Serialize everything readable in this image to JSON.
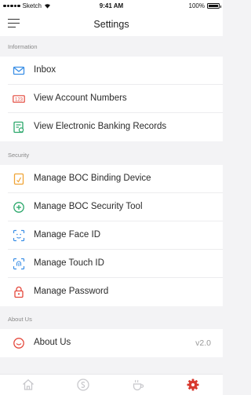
{
  "status_bar": {
    "carrier": "Sketch",
    "time": "9:41 AM",
    "battery": "100%"
  },
  "nav": {
    "title": "Settings",
    "menu_icon": "menu-icon"
  },
  "sections": [
    {
      "header": "Information",
      "items": [
        {
          "label": "Inbox",
          "icon": "envelope-icon",
          "color": "#3b8fe6"
        },
        {
          "label": "View Account Numbers",
          "icon": "account-number-icon",
          "color": "#e4483c",
          "icon_text": "123"
        },
        {
          "label": "View Electronic Banking Records",
          "icon": "records-icon",
          "color": "#2aa76a"
        }
      ]
    },
    {
      "header": "Security",
      "items": [
        {
          "label": "Manage BOC Binding Device",
          "icon": "device-icon",
          "color": "#f0a436"
        },
        {
          "label": "Manage BOC Security Tool",
          "icon": "shield-plus-icon",
          "color": "#2aa76a"
        },
        {
          "label": "Manage Face ID",
          "icon": "face-id-icon",
          "color": "#3b8fe6"
        },
        {
          "label": "Manage Touch ID",
          "icon": "touch-id-icon",
          "color": "#3b8fe6"
        },
        {
          "label": "Manage Password",
          "icon": "lock-icon",
          "color": "#e4483c"
        }
      ]
    },
    {
      "header": "About Us",
      "items": [
        {
          "label": "About Us",
          "icon": "info-smile-icon",
          "color": "#e4483c",
          "value": "v2.0"
        }
      ]
    }
  ],
  "tab_bar": [
    {
      "icon": "home-icon",
      "active": false
    },
    {
      "icon": "money-icon",
      "active": false
    },
    {
      "icon": "cup-icon",
      "active": false
    },
    {
      "icon": "settings-gear-icon",
      "active": true
    }
  ],
  "colors": {
    "active_tab": "#d83a2f",
    "inactive_tab": "#c8c8cc"
  }
}
